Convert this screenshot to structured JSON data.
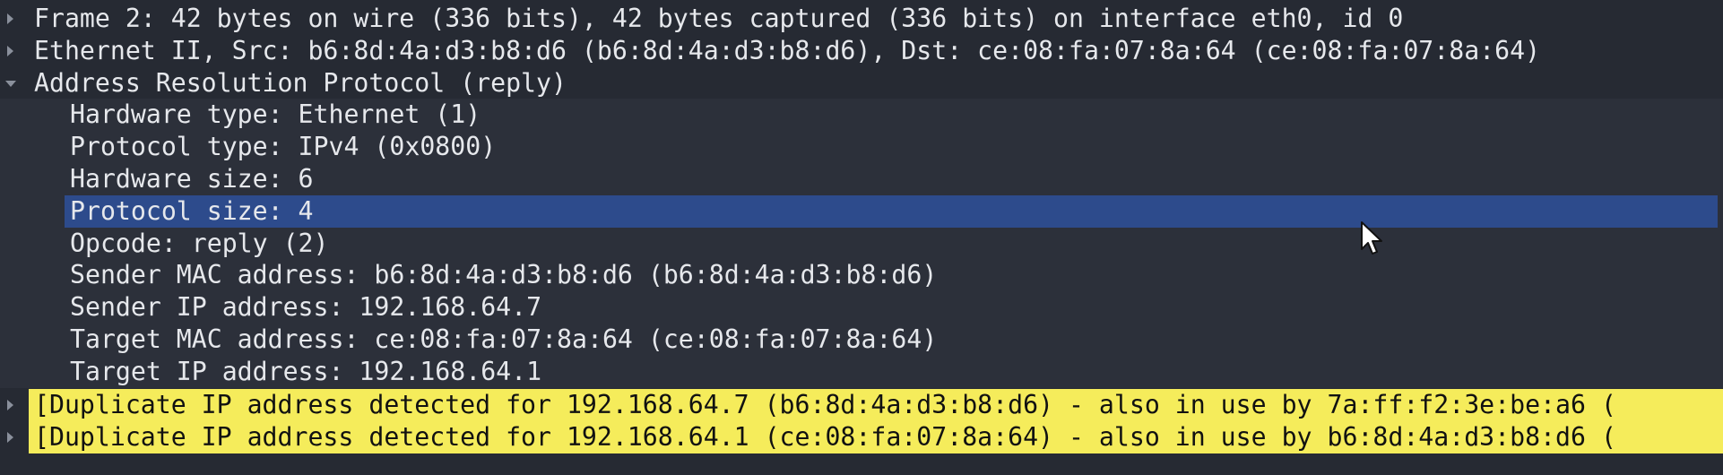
{
  "rows": [
    {
      "text": "Frame 2: 42 bytes on wire (336 bits), 42 bytes captured (336 bits) on interface eth0, id 0",
      "expander": "collapsed",
      "state": "normal"
    },
    {
      "text": "Ethernet II, Src: b6:8d:4a:d3:b8:d6 (b6:8d:4a:d3:b8:d6), Dst: ce:08:fa:07:8a:64 (ce:08:fa:07:8a:64)",
      "expander": "collapsed",
      "state": "normal"
    },
    {
      "text": "Address Resolution Protocol (reply)",
      "expander": "expanded",
      "state": "normal"
    },
    {
      "text": "Hardware type: Ethernet (1)",
      "expander": "none",
      "state": "normal"
    },
    {
      "text": "Protocol type: IPv4 (0x0800)",
      "expander": "none",
      "state": "normal"
    },
    {
      "text": "Hardware size: 6",
      "expander": "none",
      "state": "normal"
    },
    {
      "text": "Protocol size: 4",
      "expander": "none",
      "state": "selected"
    },
    {
      "text": "Opcode: reply (2)",
      "expander": "none",
      "state": "normal"
    },
    {
      "text": "Sender MAC address: b6:8d:4a:d3:b8:d6 (b6:8d:4a:d3:b8:d6)",
      "expander": "none",
      "state": "normal"
    },
    {
      "text": "Sender IP address: 192.168.64.7",
      "expander": "none",
      "state": "normal"
    },
    {
      "text": "Target MAC address: ce:08:fa:07:8a:64 (ce:08:fa:07:8a:64)",
      "expander": "none",
      "state": "normal"
    },
    {
      "text": "Target IP address: 192.168.64.1",
      "expander": "none",
      "state": "normal"
    },
    {
      "text": "[Duplicate IP address detected for 192.168.64.7 (b6:8d:4a:d3:b8:d6) - also in use by 7a:ff:f2:3e:be:a6 (",
      "expander": "collapsed",
      "state": "warning"
    },
    {
      "text": "[Duplicate IP address detected for 192.168.64.1 (ce:08:fa:07:8a:64) - also in use by b6:8d:4a:d3:b8:d6 (",
      "expander": "collapsed",
      "state": "warning"
    }
  ],
  "colors": {
    "background": "#262a33",
    "selected": "#2d4b8c",
    "warning": "#f5ec5b",
    "text": "#e6e8ec"
  },
  "icons": {
    "collapsed": "triangle-right-icon",
    "expanded": "triangle-down-icon",
    "pointer": "mouse-pointer-icon"
  }
}
